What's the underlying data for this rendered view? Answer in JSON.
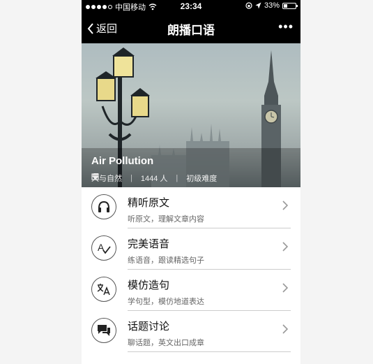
{
  "status_bar": {
    "carrier": "中国移动",
    "time": "23:34",
    "battery": "33%"
  },
  "nav": {
    "back_label": "返回",
    "title": "朗播口语",
    "more_label": "•••"
  },
  "hero": {
    "title": "Air Pollution",
    "category": "人与自然",
    "learners": "1444 人",
    "level": "初级难度"
  },
  "menu": [
    {
      "title": "精听原文",
      "subtitle": "听原文，理解文章内容",
      "icon": "headphones-icon"
    },
    {
      "title": "完美语音",
      "subtitle": "练语音，跟读精选句子",
      "icon": "pronunciation-icon"
    },
    {
      "title": "模仿造句",
      "subtitle": "学句型，模仿地道表达",
      "icon": "translate-icon"
    },
    {
      "title": "话题讨论",
      "subtitle": "聊话题，英文出口成章",
      "icon": "chat-icon"
    }
  ]
}
